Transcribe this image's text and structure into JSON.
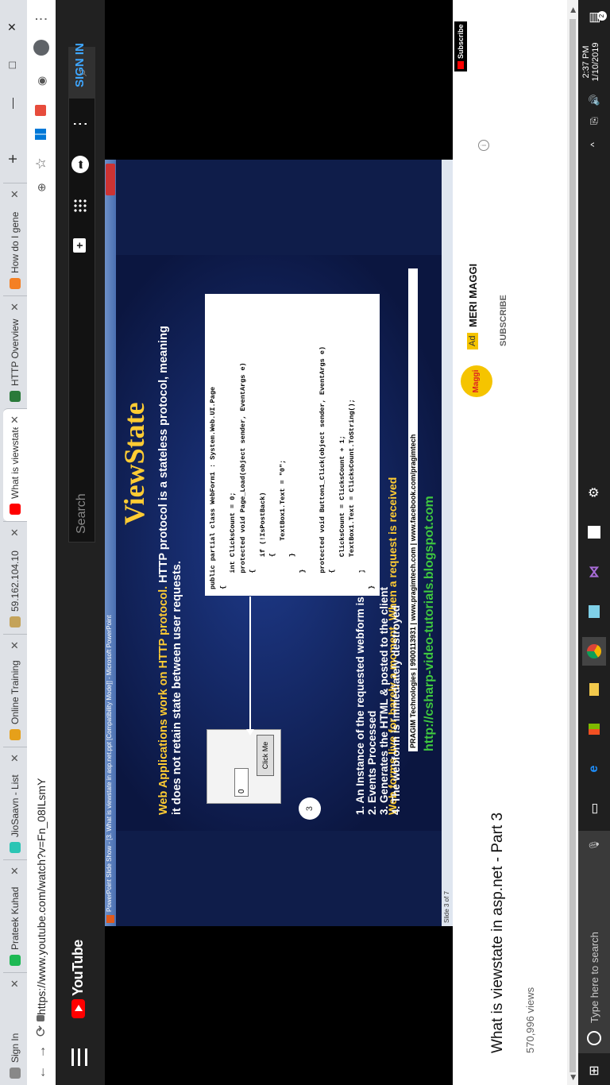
{
  "browser": {
    "tabs": [
      {
        "title": "Sign In",
        "color": "#888"
      },
      {
        "title": "Prateek Kuhad",
        "color": "#1db954"
      },
      {
        "title": "JioSaavn - List",
        "color": "#2bc5b4"
      },
      {
        "title": "Online Training",
        "color": "#e6a01a"
      },
      {
        "title": "59.162.104.10",
        "color": "#c4a35a"
      },
      {
        "title": "What is viewstate",
        "color": "#ff0000"
      },
      {
        "title": "HTTP Overview",
        "color": "#2a7a3a"
      },
      {
        "title": "How do I gene",
        "color": "#f48024"
      }
    ],
    "new_tab": "+",
    "window_controls": {
      "minimize": "—",
      "maximize": "□",
      "close": "✕"
    },
    "url": "https://www.youtube.com/watch?v=Fn_08ILsmY"
  },
  "youtube": {
    "logo_text": "YouTube",
    "search_placeholder": "Search",
    "sign_in": "SIGN IN",
    "video_title": "What is viewstate in asp.net - Part 3",
    "views_partial": "570,996 views",
    "ad_badge": "Ad",
    "ad_title": "MERI MAGGI",
    "ad_logo_text": "Maggi",
    "subscribe_partial": "SUBSCRIBE",
    "subscribe_watermark": "Subscribe"
  },
  "powerpoint": {
    "window_title": "PowerPoint Slide Show - [3. What is viewstate in asp.net.ppt [Compatibility Mode]] - Microsoft PowerPoint",
    "status": "Slide 3 of 7"
  },
  "slide": {
    "title": "ViewState",
    "intro_highlight": "Web Applications work on HTTP protocol.",
    "intro_rest_line1": " HTTP protocol is a stateless protocol, meaning",
    "intro_line2": "it does not retain state between user requests.",
    "textbox_value": "0",
    "button_label": "Click Me",
    "code_lines": [
      "public partial class WebForm1 : System.Web.UI.Page",
      "{",
      "    int ClicksCount = 0;",
      "    protected void Page_Load(object sender, EventArgs e)",
      "    {",
      "        if (!IsPostBack)",
      "        {",
      "            TextBox1.Text = \"0\";",
      "        }",
      "    }",
      "",
      "    protected void Button1_Click(object sender, EventArgs e)",
      "    {",
      "        ClicksCount = ClicksCount + 1;",
      "        TextBox1.Text = ClicksCount.ToString();",
      "    }",
      "}"
    ],
    "lifecycle_heading": "Web forms live for barely a moment. When a request is received",
    "lifecycle_items": [
      "1. An Instance of the requested webform is created",
      "2. Events Processed",
      "3. Generates the HTML & posted to the client",
      "4. The webform is immediately destroyed"
    ],
    "slide_number": "3",
    "footer": "PRAGIM Technologies | 9900113931 | www.pragimtech.com | www.facebook.com/pragimtech",
    "blog_url": "http://csharp-video-tutorials.blogspot.com"
  },
  "taskbar": {
    "search_placeholder": "Type here to search",
    "time": "2:37 PM",
    "date": "1/10/2019",
    "notification_count": "2"
  }
}
